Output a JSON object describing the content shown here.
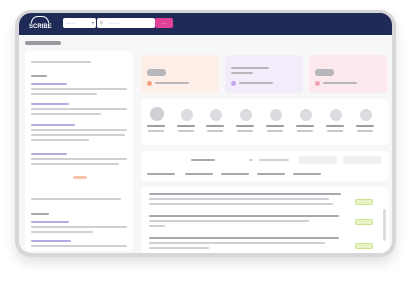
{
  "app": {
    "logo_text": "SCRIBE"
  },
  "header": {
    "select_value": "........",
    "search_placeholder": "...........",
    "search_button": "......"
  },
  "colors": {
    "header": "#1f2a57",
    "accent": "#e0429a",
    "card_orange": "#fdeee8",
    "card_purple": "#f2ecfb",
    "card_pink": "#fbe9ee",
    "badge_green": "#e8f3c8"
  },
  "icons": [
    "search-icon",
    "chevron-down-icon",
    "coin-icon",
    "bag-icon",
    "heart-icon"
  ]
}
